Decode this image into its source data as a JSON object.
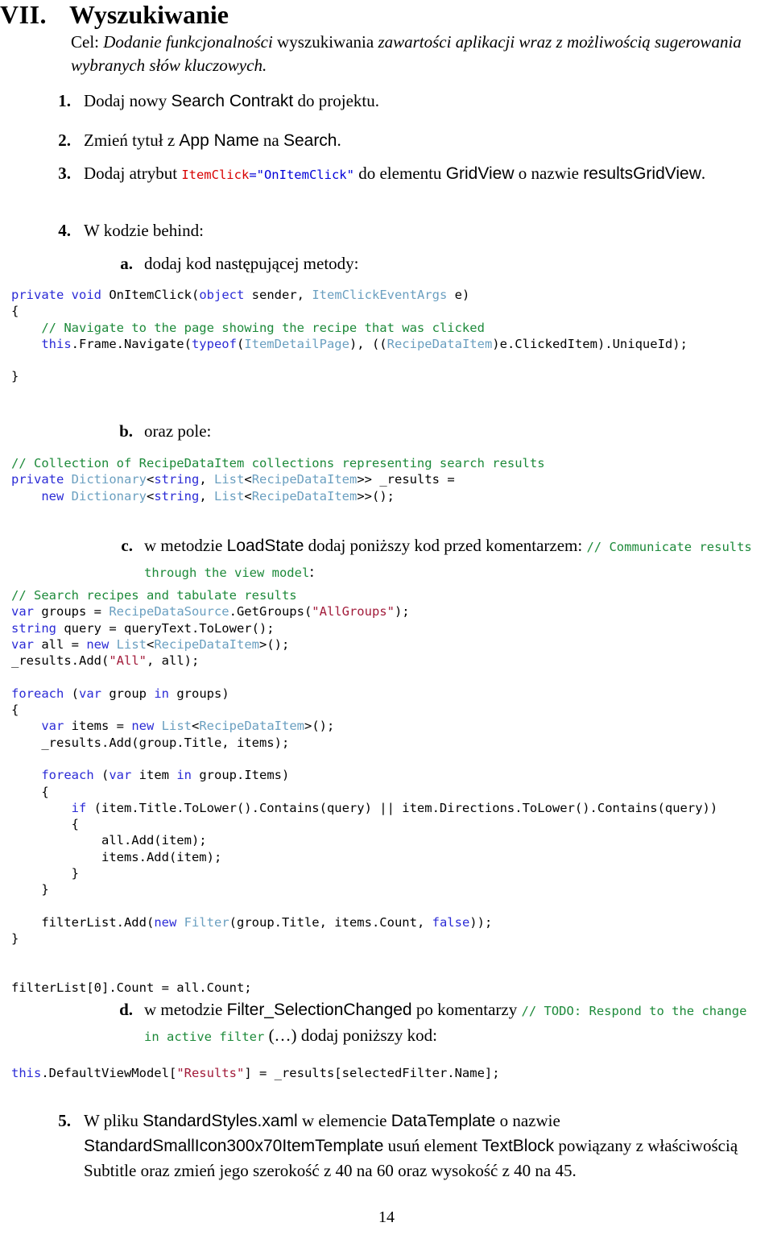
{
  "heading": {
    "number": "VII.",
    "title": "Wyszukiwanie"
  },
  "goal": {
    "label": "Cel:",
    "text_italic_1": " Dodanie funkcjonalności",
    "text_plain_1": " wyszukiwania ",
    "text_italic_2": "zawartości aplikacji wraz z możliwością sugerowania wybranych słów kluczowych."
  },
  "steps": [
    {
      "marker": "1.",
      "text": "Dodaj nowy Search Contrakt do projektu.",
      "pre": "Dodaj nowy ",
      "sans": "Search Contrakt",
      "post": " do projektu."
    },
    {
      "marker": "2.",
      "pre": "Zmień tytuł z ",
      "sans": "App Name",
      "mid": " na ",
      "sans2": "Search",
      "post": "."
    },
    {
      "marker": "3.",
      "pre": "Dodaj atrybut ",
      "code_attr": "ItemClick",
      "code_attrval": "=\"OnItemClick\"",
      "mid": " do elementu ",
      "sans": "GridView",
      "mid2": " o nazwie ",
      "sans2": "resultsGridView",
      "post": "."
    },
    {
      "marker": "4.",
      "text": "W kodzie behind:"
    },
    {
      "marker": "5.",
      "pre": "W pliku ",
      "sans": "StandardStyles.xaml",
      "mid": " w elemencie ",
      "sans2": "DataTemplate",
      "mid2": " o nazwie ",
      "sans3": "StandardSmallIcon300x70ItemTemplate",
      "mid3": " usuń element ",
      "sans4": "TextBlock",
      "post": " powiązany z właściwością Subtitle oraz zmień jego szerokość z 40 na 60 oraz wysokość z 40 na 45."
    }
  ],
  "substeps": {
    "a": {
      "marker": "a.",
      "text": "dodaj kod następującej metody:"
    },
    "b": {
      "marker": "b.",
      "text": "oraz pole:"
    },
    "c": {
      "marker": "c.",
      "pre": "w metodzie ",
      "sans": "LoadState",
      "mid": " dodaj poniższy kod przed komentarzem: ",
      "comment": "// Communicate results through the view model",
      "post": ":"
    },
    "d": {
      "marker": "d.",
      "pre": "w metodzie ",
      "sans": "Filter_SelectionChanged",
      "mid": " po komentarzy ",
      "comment": "// TODO: Respond to the change in active filter",
      "mid2": " (…) ",
      "post": "dodaj poniższy kod:"
    }
  },
  "code_blocks": {
    "on_item_click": [
      [
        {
          "t": "private",
          "c": "kw"
        },
        {
          "t": " "
        },
        {
          "t": "void",
          "c": "kw"
        },
        {
          "t": " OnItemClick("
        },
        {
          "t": "object",
          "c": "kw"
        },
        {
          "t": " sender, "
        },
        {
          "t": "ItemClickEventArgs",
          "c": "type"
        },
        {
          "t": " e)"
        }
      ],
      [
        {
          "t": "{"
        }
      ],
      [
        {
          "t": "    "
        },
        {
          "t": "// Navigate to the page showing the recipe that was clicked",
          "c": "cmt"
        }
      ],
      [
        {
          "t": "    "
        },
        {
          "t": "this",
          "c": "kw"
        },
        {
          "t": ".Frame.Navigate("
        },
        {
          "t": "typeof",
          "c": "kw"
        },
        {
          "t": "("
        },
        {
          "t": "ItemDetailPage",
          "c": "type"
        },
        {
          "t": "), (("
        },
        {
          "t": "RecipeDataItem",
          "c": "type"
        },
        {
          "t": ")e.ClickedItem).UniqueId);"
        }
      ],
      [
        {
          "t": ""
        }
      ],
      [
        {
          "t": "}"
        }
      ]
    ],
    "results_field": [
      [
        {
          "t": "// Collection of RecipeDataItem collections representing search results",
          "c": "cmt"
        }
      ],
      [
        {
          "t": "private",
          "c": "kw"
        },
        {
          "t": " "
        },
        {
          "t": "Dictionary",
          "c": "type"
        },
        {
          "t": "<"
        },
        {
          "t": "string",
          "c": "kw"
        },
        {
          "t": ", "
        },
        {
          "t": "List",
          "c": "type"
        },
        {
          "t": "<"
        },
        {
          "t": "RecipeDataItem",
          "c": "type"
        },
        {
          "t": ">> _results ="
        }
      ],
      [
        {
          "t": "    "
        },
        {
          "t": "new",
          "c": "kw"
        },
        {
          "t": " "
        },
        {
          "t": "Dictionary",
          "c": "type"
        },
        {
          "t": "<"
        },
        {
          "t": "string",
          "c": "kw"
        },
        {
          "t": ", "
        },
        {
          "t": "List",
          "c": "type"
        },
        {
          "t": "<"
        },
        {
          "t": "RecipeDataItem",
          "c": "type"
        },
        {
          "t": ">>();"
        }
      ]
    ],
    "load_state": [
      [
        {
          "t": "// Search recipes and tabulate results",
          "c": "cmt"
        }
      ],
      [
        {
          "t": "var",
          "c": "kw"
        },
        {
          "t": " groups = "
        },
        {
          "t": "RecipeDataSource",
          "c": "type"
        },
        {
          "t": ".GetGroups("
        },
        {
          "t": "\"AllGroups\"",
          "c": "str"
        },
        {
          "t": ");"
        }
      ],
      [
        {
          "t": "string",
          "c": "kw"
        },
        {
          "t": " query = queryText.ToLower();"
        }
      ],
      [
        {
          "t": "var",
          "c": "kw"
        },
        {
          "t": " all = "
        },
        {
          "t": "new",
          "c": "kw"
        },
        {
          "t": " "
        },
        {
          "t": "List",
          "c": "type"
        },
        {
          "t": "<"
        },
        {
          "t": "RecipeDataItem",
          "c": "type"
        },
        {
          "t": ">();"
        }
      ],
      [
        {
          "t": "_results.Add("
        },
        {
          "t": "\"All\"",
          "c": "str"
        },
        {
          "t": ", all);"
        }
      ],
      [
        {
          "t": ""
        }
      ],
      [
        {
          "t": "foreach",
          "c": "kw"
        },
        {
          "t": " ("
        },
        {
          "t": "var",
          "c": "kw"
        },
        {
          "t": " group "
        },
        {
          "t": "in",
          "c": "kw"
        },
        {
          "t": " groups)"
        }
      ],
      [
        {
          "t": "{"
        }
      ],
      [
        {
          "t": "    "
        },
        {
          "t": "var",
          "c": "kw"
        },
        {
          "t": " items = "
        },
        {
          "t": "new",
          "c": "kw"
        },
        {
          "t": " "
        },
        {
          "t": "List",
          "c": "type"
        },
        {
          "t": "<"
        },
        {
          "t": "RecipeDataItem",
          "c": "type"
        },
        {
          "t": ">();"
        }
      ],
      [
        {
          "t": "    _results.Add(group.Title, items);"
        }
      ],
      [
        {
          "t": ""
        }
      ],
      [
        {
          "t": "    "
        },
        {
          "t": "foreach",
          "c": "kw"
        },
        {
          "t": " ("
        },
        {
          "t": "var",
          "c": "kw"
        },
        {
          "t": " item "
        },
        {
          "t": "in",
          "c": "kw"
        },
        {
          "t": " group.Items)"
        }
      ],
      [
        {
          "t": "    {"
        }
      ],
      [
        {
          "t": "        "
        },
        {
          "t": "if",
          "c": "kw"
        },
        {
          "t": " (item.Title.ToLower().Contains(query) || item.Directions.ToLower().Contains(query))"
        }
      ],
      [
        {
          "t": "        {"
        }
      ],
      [
        {
          "t": "            all.Add(item);"
        }
      ],
      [
        {
          "t": "            items.Add(item);"
        }
      ],
      [
        {
          "t": "        }"
        }
      ],
      [
        {
          "t": "    }"
        }
      ],
      [
        {
          "t": ""
        }
      ],
      [
        {
          "t": "    filterList.Add("
        },
        {
          "t": "new",
          "c": "kw"
        },
        {
          "t": " "
        },
        {
          "t": "Filter",
          "c": "type"
        },
        {
          "t": "(group.Title, items.Count, "
        },
        {
          "t": "false",
          "c": "kw"
        },
        {
          "t": "));"
        }
      ],
      [
        {
          "t": "}"
        }
      ],
      [
        {
          "t": ""
        }
      ],
      [
        {
          "t": ""
        }
      ],
      [
        {
          "t": "filterList[0].Count = all.Count;"
        }
      ]
    ],
    "filter_selection_changed": [
      [
        {
          "t": "this",
          "c": "kw"
        },
        {
          "t": ".DefaultViewModel["
        },
        {
          "t": "\"Results\"",
          "c": "str"
        },
        {
          "t": "] = _results[selectedFilter.Name];"
        }
      ]
    ]
  },
  "footer": {
    "page_number": "14"
  },
  "colors": {
    "keyword": "#2b2bd6",
    "type": "#6a9fc0",
    "comment": "#1d8a3a",
    "string": "#a21b3a",
    "attribute": "#d80000",
    "attribute_value": "#0000d8"
  }
}
